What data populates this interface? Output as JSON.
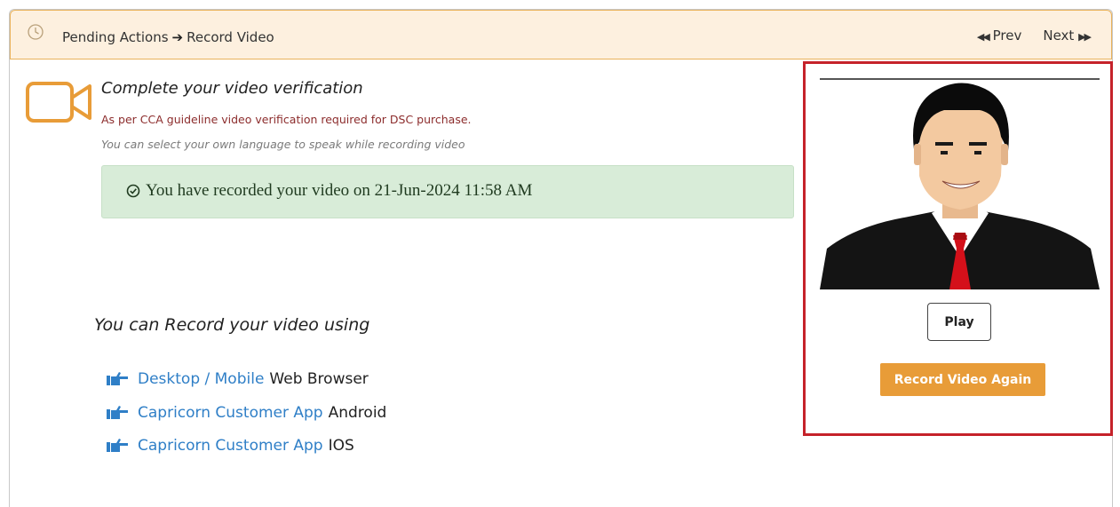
{
  "header": {
    "breadcrumb_root": "Pending Actions",
    "breadcrumb_current": "Record Video",
    "prev_label": "Prev",
    "next_label": "Next"
  },
  "verification": {
    "title": "Complete your video verification",
    "guideline": "As per CCA guideline video verification required for DSC purchase.",
    "language_note": "You can select your own language to speak while recording video",
    "recorded_message": "You have recorded your video on 21-Jun-2024 11:58 AM"
  },
  "record_options": {
    "heading": "You can Record your video using",
    "items": [
      {
        "link": "Desktop / Mobile",
        "suffix": "Web Browser"
      },
      {
        "link": "Capricorn Customer App",
        "suffix": "Android"
      },
      {
        "link": "Capricorn Customer App",
        "suffix": "IOS"
      }
    ]
  },
  "video_panel": {
    "play_label": "Play",
    "record_again_label": "Record Video Again"
  },
  "colors": {
    "header_bg": "#fdf0df",
    "header_border": "#e9b25b",
    "accent_orange": "#e89c38",
    "link_blue": "#2f7fc7",
    "highlight_red": "#c5222a",
    "success_bg": "#d8ecd8",
    "guideline_red": "#8c2c2c"
  },
  "icons": {
    "header": "pending-clock-icon",
    "camera": "video-camera-icon",
    "success": "check-circle-icon",
    "option": "pointing-hand-icon",
    "prev": "double-chevron-left-icon",
    "next": "double-chevron-right-icon"
  }
}
